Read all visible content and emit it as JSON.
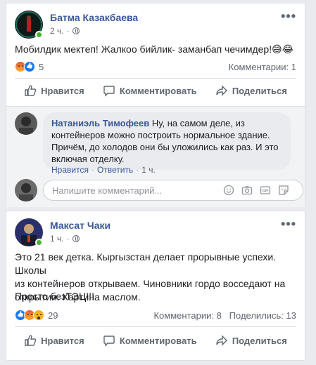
{
  "post1": {
    "author": "Батма Казакбаева",
    "time": "2 ч.",
    "text": "Мобилдик мектеп! Жалкоо бийлик- заманбап чечимдер!😅😂",
    "reactions_count": "5",
    "comments_count": "Комментарии: 1",
    "actions": {
      "like": "Нравится",
      "comment": "Комментировать",
      "share": "Поделиться"
    },
    "comment": {
      "author": "Натаниэль Тимофеев",
      "text": " Ну, на самом деле, из контейнеров можно построить нормальное здание. Причём, до холодов они бы уложились как раз. И это включая отделку.",
      "like": "Нравится",
      "reply": "Ответить",
      "time": "1 ч."
    },
    "write_placeholder": "Напишите комментарий..."
  },
  "post2": {
    "author": "Максат Чаки",
    "time": "1 ч.",
    "text_lines": [
      "Это 21 век детка. Кыргызстан делает прорывные успехи. Школы",
      "из контейнеров открываем. Чиновники гордо восседают на",
      "открытии. Картина маслом."
    ],
    "text_last": "Просто безТЭЦ!!!",
    "reactions_count": "29",
    "comments_count": "Комментарии: 8",
    "shares_count": "Поделились: 13",
    "actions": {
      "like": "Нравится",
      "comment": "Комментировать",
      "share": "Поделиться"
    }
  },
  "icons": {
    "more": "more-icon",
    "globe": "globe-icon",
    "like": "thumbs-up-icon",
    "comment": "comment-icon",
    "share": "share-icon",
    "emoji": "emoji-icon",
    "camera": "camera-icon",
    "gif": "gif-icon",
    "sticker": "sticker-icon"
  },
  "colors": {
    "link": "#385898",
    "online": "#42b72a",
    "like_blue": "#1877f2"
  }
}
